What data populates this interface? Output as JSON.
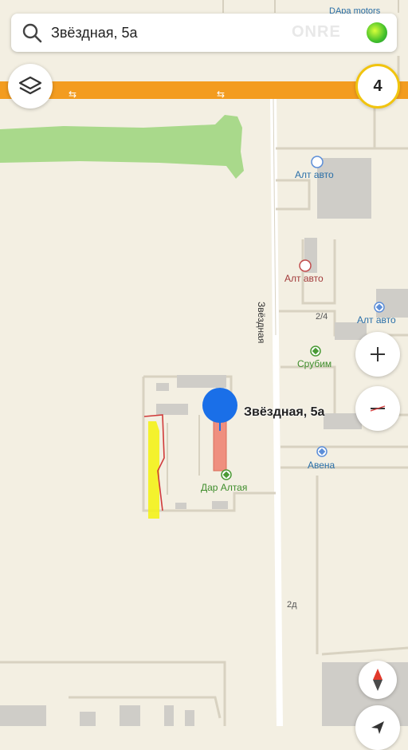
{
  "search": {
    "query": "Звёздная, 5а"
  },
  "traffic": {
    "level": "4"
  },
  "pin": {
    "label": "Звёздная, 5а"
  },
  "streets": {
    "main": "Звёздная"
  },
  "pois": [
    {
      "name": "Алт авто",
      "style": "blue"
    },
    {
      "name": "Алт авто",
      "style": "red"
    },
    {
      "name": "Алт авто",
      "style": "blue"
    },
    {
      "name": "Срубим",
      "style": "green"
    },
    {
      "name": "Авена",
      "style": "blue"
    },
    {
      "name": "Дар Алтая",
      "style": "green"
    }
  ],
  "house_numbers": [
    "2/4",
    "2д"
  ],
  "watermark": {
    "text": "ONRE",
    "top_label": "DApa motors"
  },
  "colors": {
    "background": "#f3efe2",
    "road_orange": "#f39c1f",
    "park_green": "#a9d98b",
    "pin_blue": "#1a6fe8",
    "highlight_red": "#ef8f7f",
    "marker_yellow": "#f4f21a"
  },
  "icons": {
    "search": "search-icon",
    "layers": "layers-icon",
    "zoom_in": "plus-icon",
    "zoom_out": "minus-icon",
    "compass": "compass-icon",
    "alice": "alice-assistant-icon"
  }
}
